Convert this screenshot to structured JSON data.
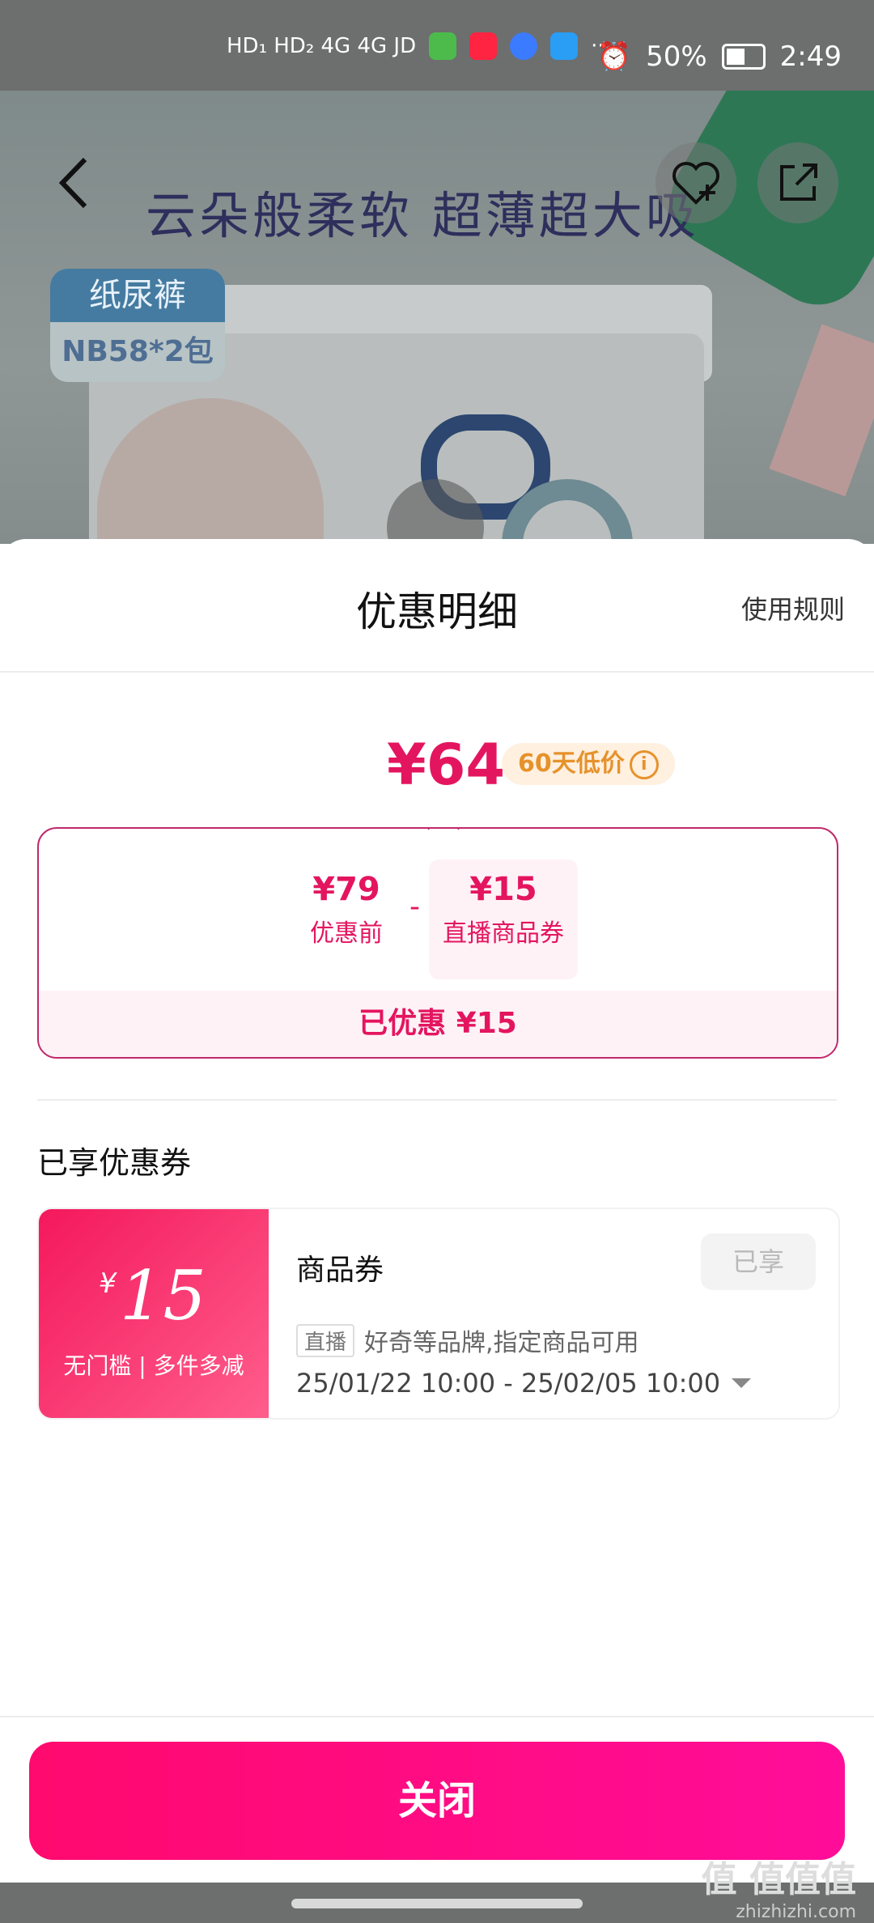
{
  "status_bar": {
    "left_text": "HD₁ HD₂ 4G 4G JD",
    "app_icons": [
      "wechat-icon",
      "xiaohongshu-icon",
      "app-icon",
      "cloud-icon"
    ],
    "more": "···",
    "battery_percent": "50%",
    "time": "2:49"
  },
  "hero": {
    "headline": "云朵般柔软  超薄超大吸",
    "tag_line1": "纸尿裤",
    "tag_line2": "NB58*2包"
  },
  "sheet": {
    "title": "优惠明细",
    "rules_link": "使用规则",
    "final_price": "¥64",
    "low_price_badge": "60天低价",
    "info_icon": "ⓘ",
    "breakdown": {
      "original_value": "¥79",
      "original_label": "优惠前",
      "minus": "-",
      "discount_value": "¥15",
      "discount_label": "直播商品券",
      "saved_text": "已优惠 ¥15"
    },
    "section_title": "已享优惠券",
    "coupon": {
      "currency": "¥",
      "amount": "15",
      "conditions": "无门槛 | 多件多减",
      "name": "商品券",
      "status": "已享",
      "badge": "直播",
      "desc": "好奇等品牌,指定商品可用",
      "validity": "25/01/22 10:00 - 25/02/05 10:00"
    },
    "close_label": "关闭"
  },
  "watermark": {
    "main": "值 值值值",
    "url": "zhizhizhi.com"
  },
  "colors": {
    "accent": "#e4155f",
    "button_start": "#ff0a6e",
    "button_end": "#ff0d99",
    "badge_orange": "#e6922b"
  }
}
